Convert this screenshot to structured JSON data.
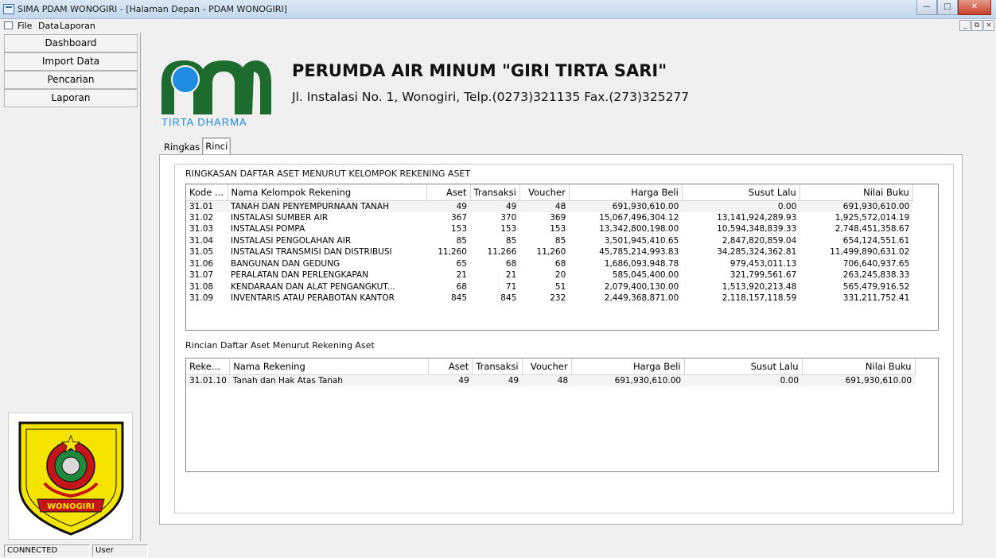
{
  "window": {
    "title": "SIMA PDAM WONOGIRI - [Halaman Depan - PDAM WONOGIRI]"
  },
  "menu": {
    "items": [
      "File",
      "Data",
      "Laporan"
    ]
  },
  "sidebar": {
    "items": [
      {
        "label": "Dashboard"
      },
      {
        "label": "Import Data"
      },
      {
        "label": "Pencarian"
      },
      {
        "label": "Laporan"
      }
    ]
  },
  "header": {
    "company": "PERUMDA AIR MINUM \"GIRI TIRTA SARI\"",
    "address": "Jl. Instalasi No. 1, Wonogiri, Telp.(0273)321135 Fax.(273)325277",
    "logo_text": "TIRTA DHARMA",
    "emblem_text": "WONOGIRI"
  },
  "colors": {
    "logo_green": "#1d6b2f",
    "logo_blue": "#1e8ce0",
    "emblem_yellow": "#f5e400",
    "emblem_red": "#c4151b"
  },
  "tabs": [
    {
      "label": "Ringkas"
    },
    {
      "label": "Rinci",
      "active": true
    }
  ],
  "summary": {
    "title": "RINGKASAN DAFTAR ASET MENURUT KELOMPOK REKENING ASET",
    "columns": [
      "Kode ...",
      "Nama Kelompok Rekening",
      "Aset",
      "Transaksi",
      "Voucher",
      "Harga Beli",
      "Susut Lalu",
      "Nilai Buku"
    ],
    "rows": [
      [
        "31.01",
        "TANAH DAN PENYEMPURNAAN TANAH",
        "49",
        "49",
        "48",
        "691,930,610.00",
        "0.00",
        "691,930,610.00"
      ],
      [
        "31.02",
        "INSTALASI SUMBER AIR",
        "367",
        "370",
        "369",
        "15,067,496,304.12",
        "13,141,924,289.93",
        "1,925,572,014.19"
      ],
      [
        "31.03",
        "INSTALASI POMPA",
        "153",
        "153",
        "153",
        "13,342,800,198.00",
        "10,594,348,839.33",
        "2,748,451,358.67"
      ],
      [
        "31.04",
        "INSTALASI PENGOLAHAN AIR",
        "85",
        "85",
        "85",
        "3,501,945,410.65",
        "2,847,820,859.04",
        "654,124,551.61"
      ],
      [
        "31.05",
        "INSTALASI TRANSMISI DAN DISTRIBUSI",
        "11,260",
        "11,266",
        "11,260",
        "45,785,214,993.83",
        "34,285,324,362.81",
        "11,499,890,631.02"
      ],
      [
        "31.06",
        "BANGUNAN DAN GEDUNG",
        "65",
        "68",
        "68",
        "1,686,093,948.78",
        "979,453,011.13",
        "706,640,937.65"
      ],
      [
        "31.07",
        "PERALATAN DAN PERLENGKAPAN",
        "21",
        "21",
        "20",
        "585,045,400.00",
        "321,799,561.67",
        "263,245,838.33"
      ],
      [
        "31.08",
        "KENDARAAN DAN ALAT PENGANGKUT...",
        "68",
        "71",
        "51",
        "2,079,400,130.00",
        "1,513,920,213.48",
        "565,479,916.52"
      ],
      [
        "31.09",
        "INVENTARIS ATAU PERABOTAN KANTOR",
        "845",
        "845",
        "232",
        "2,449,368,871.00",
        "2,118,157,118.59",
        "331,211,752.41"
      ]
    ]
  },
  "detail": {
    "title": "Rincian Daftar Aset Menurut Rekening Aset",
    "columns": [
      "Reke...",
      "Nama Rekening",
      "Aset",
      "Transaksi",
      "Voucher",
      "Harga Beli",
      "Susut Lalu",
      "Nilai Buku"
    ],
    "rows": [
      [
        "31.01.10",
        "Tanah dan Hak Atas Tanah",
        "49",
        "49",
        "48",
        "691,930,610.00",
        "0.00",
        "691,930,610.00"
      ]
    ]
  },
  "status": {
    "connection": "CONNECTED",
    "user": "User"
  }
}
